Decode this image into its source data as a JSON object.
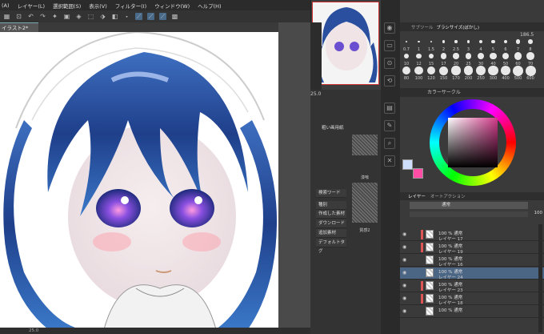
{
  "menubar": {
    "items": [
      "(A)",
      "レイヤー(L)",
      "選択範囲(S)",
      "表示(V)",
      "フィルター(I)",
      "ウィンドウ(W)",
      "ヘルプ(H)"
    ]
  },
  "document": {
    "tab": "イラスト2*"
  },
  "status": {
    "zoom": "25.0"
  },
  "brush": {
    "tabs": [
      "サブツール",
      "ブラシサイズ(ぼかし)"
    ],
    "size": "186.5",
    "sizes": [
      "0.7",
      "1",
      "1.5",
      "2",
      "2.5",
      "3",
      "4",
      "5",
      "6",
      "7",
      "8",
      "10",
      "12",
      "15",
      "17",
      "20",
      "25",
      "30",
      "40",
      "50",
      "60",
      "70",
      "80",
      "100",
      "120",
      "150",
      "170",
      "200",
      "250",
      "300",
      "400",
      "500",
      "600"
    ]
  },
  "color": {
    "tab": "カラーサークル",
    "main": "#cfe0ff",
    "sub": "#ff4da6",
    "hue": "#d23a8a"
  },
  "material": {
    "zoom": "25.0",
    "list": [
      "粗い画用紙",
      "漆喰",
      "質感2"
    ],
    "buttons": [
      "検索ワード",
      "種別",
      "作成した素材",
      "ダウンロード",
      "追加素材",
      "デフォルトタグ"
    ]
  },
  "layers": {
    "tabs": [
      "レイヤー",
      "オートアクション"
    ],
    "blend": "通常",
    "opacity": "100",
    "rows": [
      {
        "mode": "100 % 通常",
        "name": "レイヤー 17",
        "clip": true
      },
      {
        "mode": "100 % 通常",
        "name": "レイヤー 19",
        "clip": true
      },
      {
        "mode": "100 % 通常",
        "name": "レイヤー 16",
        "clip": false
      },
      {
        "mode": "100 % 通常",
        "name": "レイヤー 24",
        "clip": false,
        "selected": true
      },
      {
        "mode": "100 % 通常",
        "name": "レイヤー 23",
        "clip": true
      },
      {
        "mode": "100 % 通常",
        "name": "レイヤー 18",
        "clip": true
      },
      {
        "mode": "100 % 通常",
        "name": "",
        "clip": false
      }
    ]
  }
}
